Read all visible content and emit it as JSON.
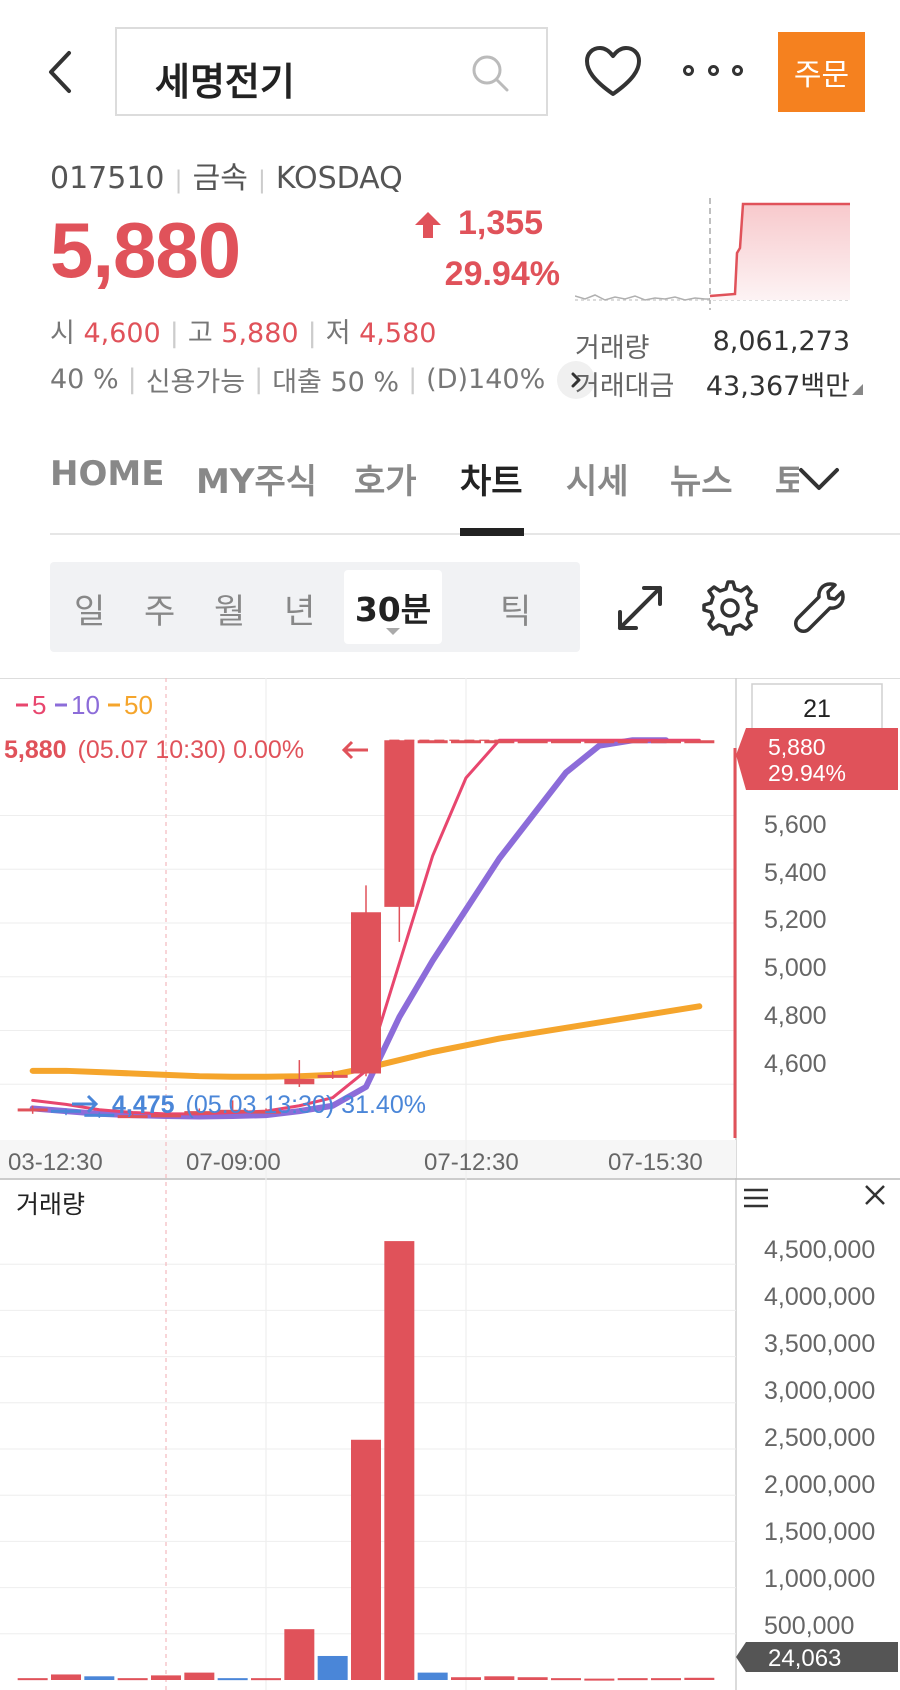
{
  "header": {
    "search_value": "세명전기",
    "order_label": "주문"
  },
  "stock": {
    "code": "017510",
    "sector": "금속",
    "market": "KOSDAQ",
    "price": "5,880",
    "change": "1,355",
    "change_pct": "29.94%",
    "open_label": "시",
    "open": "4,600",
    "high_label": "고",
    "high": "5,880",
    "low_label": "저",
    "low": "4,580",
    "margin": "40 %",
    "credit": "신용가능",
    "loan": "대출 50 %",
    "deposit": "(D)140%",
    "volume_label": "거래량",
    "volume": "8,061,273",
    "amount_label": "거래대금",
    "amount": "43,367백만"
  },
  "tabs": [
    {
      "label": "HOME",
      "active": false
    },
    {
      "label": "MY주식",
      "active": false
    },
    {
      "label": "호가",
      "active": false
    },
    {
      "label": "차트",
      "active": true
    },
    {
      "label": "시세",
      "active": false
    },
    {
      "label": "뉴스",
      "active": false
    },
    {
      "label": "토",
      "active": false
    }
  ],
  "periods": [
    {
      "label": "일"
    },
    {
      "label": "주"
    },
    {
      "label": "월"
    },
    {
      "label": "년"
    },
    {
      "label": "30분",
      "active": true
    },
    {
      "label": "틱"
    }
  ],
  "chart": {
    "ma_legend": [
      {
        "label": "5",
        "color": "#e8466e"
      },
      {
        "label": "10",
        "color": "#8c6cd9"
      },
      {
        "label": "50",
        "color": "#f5a52c"
      }
    ],
    "max_label_price": "5,880",
    "max_label_info": "(05.07 10:30) 0.00%",
    "min_label_price": "4,475",
    "min_label_info": "(05.03 13:30) 31.40%",
    "period_input": "21",
    "current_price": "5,880",
    "current_pct": "29.94%",
    "price_axis": [
      "5,600",
      "5,400",
      "5,200",
      "5,000",
      "4,800",
      "4,600"
    ],
    "time_axis": [
      "03-12:30",
      "07-09:00",
      "07-12:30",
      "07-15:30"
    ],
    "volume_title": "거래량",
    "volume_axis": [
      "4,500,000",
      "4,000,000",
      "3,500,000",
      "3,000,000",
      "2,500,000",
      "2,000,000",
      "1,500,000",
      "1,000,000",
      "500,000"
    ],
    "current_volume": "24,063",
    "colors": {
      "up": "#e0525a",
      "down": "#4a86d8",
      "ma5": "#e8466e",
      "ma10": "#8c6cd9",
      "ma50": "#f5a52c"
    }
  },
  "chart_data": {
    "type": "candlestick",
    "interval": "30분",
    "candles": [
      {
        "open": 4500,
        "close": 4510,
        "high": 4520,
        "low": 4490,
        "dir": "up"
      },
      {
        "open": 4505,
        "close": 4495,
        "high": 4510,
        "low": 4485,
        "dir": "down"
      },
      {
        "open": 4490,
        "close": 4480,
        "high": 4495,
        "low": 4475,
        "dir": "down"
      },
      {
        "open": 4480,
        "close": 4485,
        "high": 4495,
        "low": 4478,
        "dir": "up"
      },
      {
        "open": 4485,
        "close": 4488,
        "high": 4495,
        "low": 4480,
        "dir": "up"
      },
      {
        "open": 4490,
        "close": 4500,
        "high": 4510,
        "low": 4485,
        "dir": "up"
      },
      {
        "open": 4500,
        "close": 4505,
        "high": 4540,
        "low": 4495,
        "dir": "up"
      },
      {
        "open": 4500,
        "close": 4502,
        "high": 4510,
        "low": 4495,
        "dir": "up"
      },
      {
        "open": 4600,
        "close": 4620,
        "high": 4690,
        "low": 4590,
        "dir": "up"
      },
      {
        "open": 4630,
        "close": 4635,
        "high": 4650,
        "low": 4620,
        "dir": "up"
      },
      {
        "open": 4640,
        "close": 5240,
        "high": 5340,
        "low": 4630,
        "dir": "up"
      },
      {
        "open": 5260,
        "close": 5880,
        "high": 5880,
        "low": 5130,
        "dir": "up"
      },
      {
        "open": 5880,
        "close": 5880,
        "high": 5880,
        "low": 5880,
        "dir": "flat"
      },
      {
        "open": 5880,
        "close": 5880,
        "high": 5880,
        "low": 5880,
        "dir": "flat"
      },
      {
        "open": 5880,
        "close": 5880,
        "high": 5880,
        "low": 5880,
        "dir": "flat"
      },
      {
        "open": 5880,
        "close": 5880,
        "high": 5880,
        "low": 5880,
        "dir": "flat"
      },
      {
        "open": 5880,
        "close": 5880,
        "high": 5880,
        "low": 5880,
        "dir": "flat"
      },
      {
        "open": 5880,
        "close": 5880,
        "high": 5880,
        "low": 5880,
        "dir": "flat"
      },
      {
        "open": 5880,
        "close": 5880,
        "high": 5880,
        "low": 5880,
        "dir": "flat"
      },
      {
        "open": 5880,
        "close": 5880,
        "high": 5880,
        "low": 5880,
        "dir": "flat"
      },
      {
        "open": 5880,
        "close": 5880,
        "high": 5880,
        "low": 5880,
        "dir": "flat"
      }
    ],
    "ma5": [
      4540,
      4525,
      4505,
      4495,
      4490,
      4490,
      4495,
      4500,
      4520,
      4550,
      4650,
      5050,
      5450,
      5740,
      5880,
      5880,
      5880,
      5880,
      5880,
      5880,
      5880
    ],
    "ma10": [
      4510,
      4500,
      4490,
      4485,
      4482,
      4480,
      4482,
      4485,
      4500,
      4520,
      4590,
      4850,
      5060,
      5250,
      5440,
      5600,
      5760,
      5860,
      5880,
      5880,
      null
    ],
    "ma50": [
      4650,
      4650,
      4645,
      4640,
      4635,
      4630,
      4628,
      4628,
      4630,
      4635,
      4660,
      4690,
      4720,
      4745,
      4770,
      4790,
      4810,
      4830,
      4850,
      4870,
      4890
    ],
    "volume": [
      20000,
      60000,
      40000,
      20000,
      50000,
      80000,
      20000,
      20000,
      550000,
      260000,
      2600000,
      4750000,
      80000,
      30000,
      40000,
      30000,
      20000,
      15000,
      20000,
      20000,
      24063
    ],
    "volume_dir": [
      "up",
      "up",
      "down",
      "up",
      "up",
      "up",
      "down",
      "up",
      "up",
      "down",
      "up",
      "up",
      "down",
      "up",
      "up",
      "up",
      "up",
      "up",
      "up",
      "up",
      "up"
    ],
    "y_price_range": [
      4400,
      6000
    ],
    "y_volume_range": [
      0,
      5000000
    ],
    "x_labels": [
      "03-12:30",
      "07-09:00",
      "07-12:30",
      "07-15:30"
    ]
  }
}
